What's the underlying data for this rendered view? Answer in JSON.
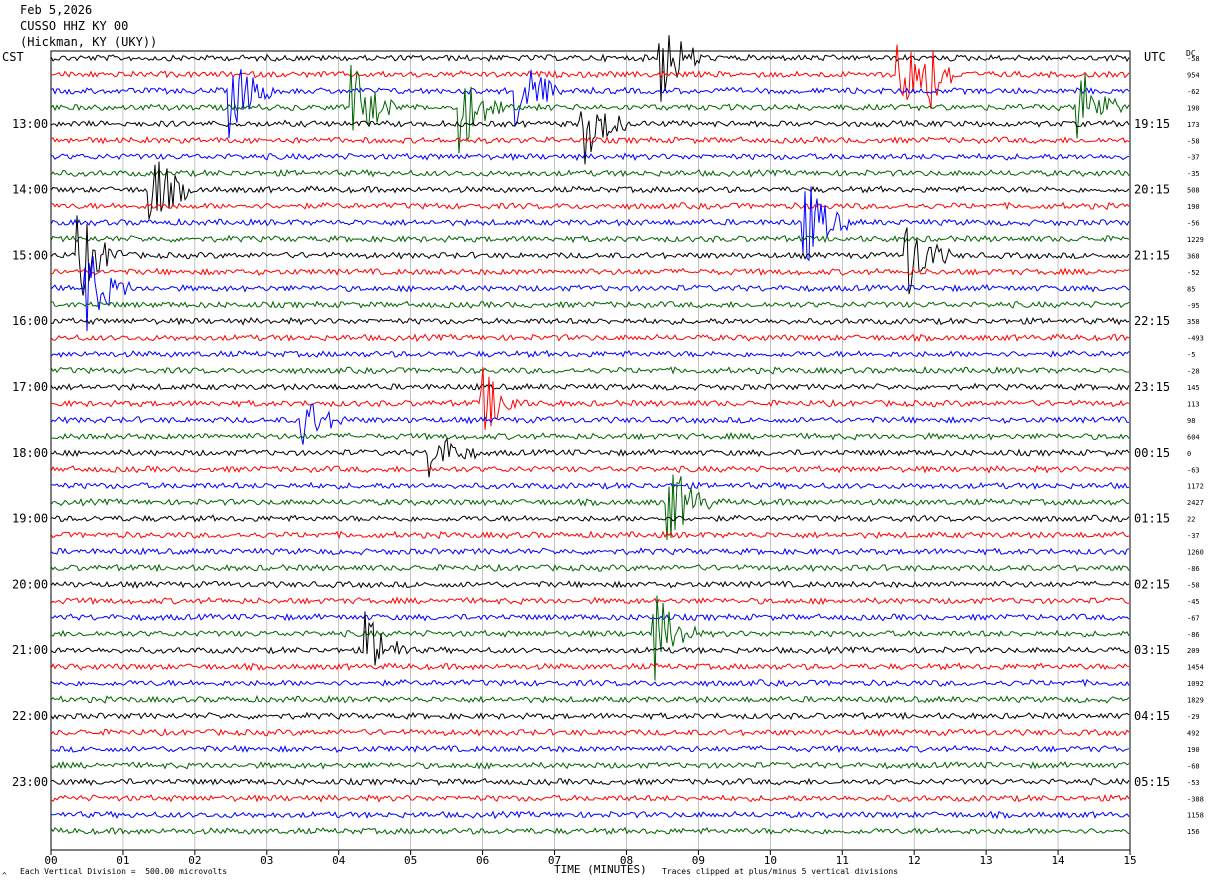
{
  "header": {
    "date": "Feb 5,2026",
    "station": "CUSSO HHZ KY 00",
    "location": "(Hickman, KY (UKY))"
  },
  "left_zone": "CST",
  "right_zone": "UTC",
  "dc_label": "DC",
  "footer": {
    "scale_note": "Each Vertical Division =  500.00 microvolts",
    "xaxis_title": "TIME (MINUTES)",
    "clip_note": "Traces clipped at plus/minus 5 vertical divisions",
    "logo_mark": "^"
  },
  "chart_data": {
    "type": "line",
    "subtype": "helicorder seismogram",
    "xlabel": "TIME (MINUTES)",
    "xlim": [
      0,
      15
    ],
    "x_ticks": [
      "00",
      "01",
      "02",
      "03",
      "04",
      "05",
      "06",
      "07",
      "08",
      "09",
      "10",
      "11",
      "12",
      "13",
      "14",
      "15"
    ],
    "rows_per_hour": 4,
    "trace_colors": [
      "#000000",
      "#ff0000",
      "#0000ff",
      "#006400"
    ],
    "grid": true,
    "left_hour_labels": [
      "13:00",
      "14:00",
      "15:00",
      "16:00",
      "17:00",
      "18:00",
      "19:00",
      "20:00",
      "21:00",
      "22:00",
      "23:00"
    ],
    "right_hour_labels": [
      "19:15",
      "20:15",
      "21:15",
      "22:15",
      "23:15",
      "00:15",
      "01:15",
      "02:15",
      "03:15",
      "04:15",
      "05:15"
    ],
    "dc_offsets": [
      "-58",
      "954",
      "-62",
      "190",
      "173",
      "-58",
      "-37",
      "-35",
      "508",
      "190",
      "-56",
      "1229",
      "368",
      "-52",
      "85",
      "-95",
      "358",
      "-493",
      "-5",
      "-28",
      "145",
      "113",
      "98",
      "604",
      "0",
      "-63",
      "1172",
      "2427",
      "22",
      "-37",
      "1260",
      "-86",
      "-58",
      "-45",
      "-67",
      "-86",
      "209",
      "1454",
      "1092",
      "1829",
      "-29",
      "492",
      "190",
      "-68",
      "-53",
      "-388",
      "1158",
      "156"
    ],
    "events": [
      {
        "minute": 2.5,
        "row": 2,
        "amp": 5,
        "color": 1
      },
      {
        "minute": 8.5,
        "row": 0,
        "amp": 5,
        "color": 0
      },
      {
        "minute": 11.8,
        "row": 1,
        "amp": 5,
        "color": 1
      },
      {
        "minute": 12.1,
        "row": 1,
        "amp": 5,
        "color": 1
      },
      {
        "minute": 5.7,
        "row": 3,
        "amp": 5,
        "color": 3
      },
      {
        "minute": 6.5,
        "row": 2,
        "amp": 5,
        "color": 2
      },
      {
        "minute": 7.4,
        "row": 4,
        "amp": 5,
        "color": 1
      },
      {
        "minute": 4.2,
        "row": 3,
        "amp": 5,
        "color": 0
      },
      {
        "minute": 1.4,
        "row": 8,
        "amp": 5,
        "color": 0
      },
      {
        "minute": 0.4,
        "row": 12,
        "amp": 5,
        "color": 0
      },
      {
        "minute": 0.5,
        "row": 14,
        "amp": 5,
        "color": 2
      },
      {
        "minute": 10.5,
        "row": 10,
        "amp": 5,
        "color": 2
      },
      {
        "minute": 11.9,
        "row": 12,
        "amp": 5,
        "color": 0
      },
      {
        "minute": 14.3,
        "row": 3,
        "amp": 5,
        "color": 3
      },
      {
        "minute": 8.6,
        "row": 27,
        "amp": 5,
        "color": 3
      },
      {
        "minute": 8.4,
        "row": 35,
        "amp": 5,
        "color": 3
      },
      {
        "minute": 4.4,
        "row": 36,
        "amp": 4,
        "color": 0
      },
      {
        "minute": 6.0,
        "row": 21,
        "amp": 4,
        "color": 1
      },
      {
        "minute": 5.3,
        "row": 24,
        "amp": 3,
        "color": 0
      },
      {
        "minute": 3.5,
        "row": 22,
        "amp": 3,
        "color": 2
      }
    ]
  }
}
